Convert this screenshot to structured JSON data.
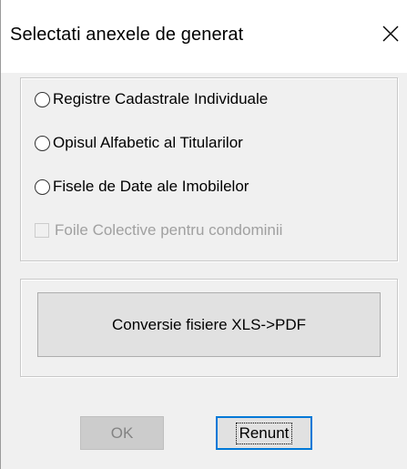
{
  "window": {
    "title": "Selectati anexele de generat",
    "close_icon": "close-icon"
  },
  "options": {
    "items": [
      {
        "label": "Registre Cadastrale Individuale",
        "type": "radio",
        "checked": false,
        "enabled": true
      },
      {
        "label": "Opisul Alfabetic al Titularilor",
        "type": "radio",
        "checked": false,
        "enabled": true
      },
      {
        "label": "Fisele de Date ale Imobilelor",
        "type": "radio",
        "checked": false,
        "enabled": true
      },
      {
        "label": "Foile Colective pentru condominii",
        "type": "checkbox",
        "checked": false,
        "enabled": false
      }
    ]
  },
  "convert": {
    "label": "Conversie fisiere XLS->PDF"
  },
  "buttons": {
    "ok_label": "OK",
    "ok_enabled": false,
    "cancel_label": "Renunt",
    "cancel_focused": true
  },
  "colors": {
    "focus_border": "#0078d7",
    "dialog_bg": "#f0f0f0",
    "disabled_text": "#a0a0a0"
  }
}
